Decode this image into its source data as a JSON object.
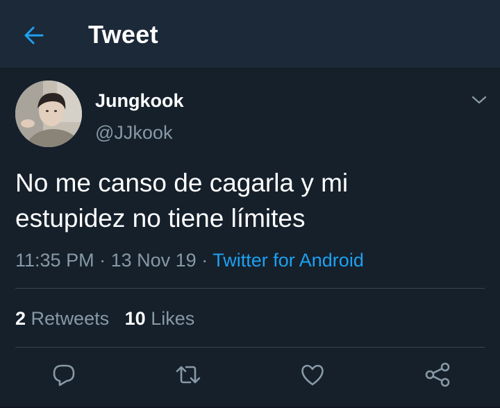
{
  "header": {
    "title": "Tweet",
    "back_icon": "arrow-left-icon"
  },
  "tweet": {
    "author": {
      "name": "Jungkook",
      "handle": "@JJkook"
    },
    "text_line1": "No me canso de cagarla y mi",
    "text_line2": "estupidez no tiene límites",
    "time": "11:35 PM",
    "separator": "·",
    "date": "13 Nov 19",
    "source": "Twitter for Android",
    "retweets_count": "2",
    "retweets_label": "Retweets",
    "likes_count": "10",
    "likes_label": "Likes"
  },
  "actions": [
    "reply-icon",
    "retweet-icon",
    "like-icon",
    "share-icon"
  ],
  "colors": {
    "background": "#15202b",
    "header": "#1c2938",
    "accent": "#1da1f2",
    "secondary_text": "#8899a6",
    "divider": "#38444d"
  }
}
